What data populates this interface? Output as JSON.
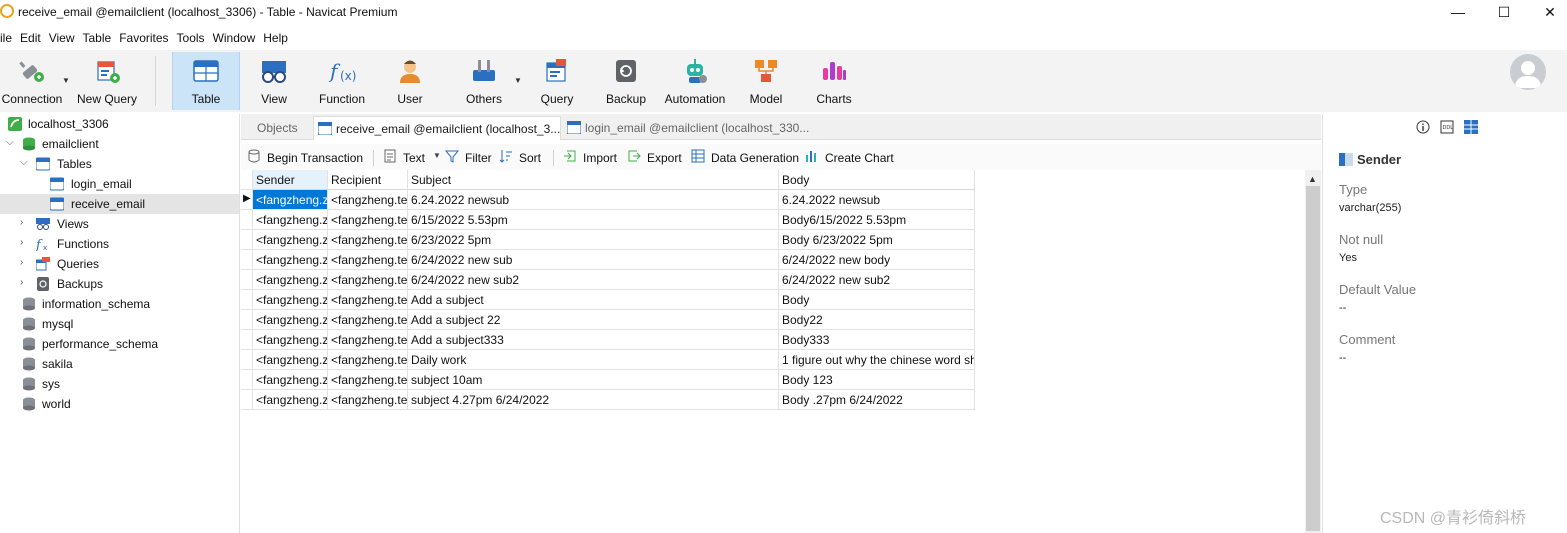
{
  "window": {
    "title": "receive_email @emailclient (localhost_3306) - Table - Navicat Premium",
    "minimize_glyph": "—",
    "maximize_glyph": "☐",
    "close_glyph": "✕"
  },
  "menu": [
    "ile",
    "Edit",
    "View",
    "Table",
    "Favorites",
    "Tools",
    "Window",
    "Help"
  ],
  "toolbar": {
    "connection": "Connection",
    "new_query": "New Query",
    "table": "Table",
    "view": "View",
    "function": "Function",
    "user": "User",
    "others": "Others",
    "query": "Query",
    "backup": "Backup",
    "automation": "Automation",
    "model": "Model",
    "charts": "Charts"
  },
  "tree": {
    "connection": "localhost_3306",
    "database": "emailclient",
    "tables": "Tables",
    "table_login": "login_email",
    "table_receive": "receive_email",
    "views": "Views",
    "functions": "Functions",
    "queries": "Queries",
    "backups": "Backups",
    "other_dbs": [
      "information_schema",
      "mysql",
      "performance_schema",
      "sakila",
      "sys",
      "world"
    ]
  },
  "tabs": {
    "objects": "Objects",
    "receive": "receive_email @emailclient (localhost_3...",
    "login": "login_email @emailclient (localhost_330..."
  },
  "object_toolbar": {
    "begin_transaction": "Begin Transaction",
    "text": "Text",
    "filter": "Filter",
    "sort": "Sort",
    "import": "Import",
    "export": "Export",
    "data_generation": "Data Generation",
    "create_chart": "Create Chart"
  },
  "grid": {
    "columns": [
      "Sender",
      "Recipient",
      "Subject",
      "Body"
    ],
    "rows": [
      [
        "<fangzheng.z",
        "<fangzheng.te",
        "6.24.2022 newsub",
        "6.24.2022 newsub"
      ],
      [
        "<fangzheng.z",
        "<fangzheng.te",
        "6/15/2022 5.53pm",
        "Body6/15/2022 5.53pm"
      ],
      [
        "<fangzheng.z",
        "<fangzheng.te",
        "6/23/2022 5pm",
        "Body 6/23/2022 5pm"
      ],
      [
        "<fangzheng.z",
        "<fangzheng.te",
        "6/24/2022 new sub",
        "6/24/2022 new body"
      ],
      [
        "<fangzheng.z",
        "<fangzheng.te",
        "6/24/2022 new sub2",
        "6/24/2022 new sub2"
      ],
      [
        "<fangzheng.z",
        "<fangzheng.te",
        "Add a subject",
        "Body"
      ],
      [
        "<fangzheng.z",
        "<fangzheng.te",
        "Add a subject 22",
        "Body22"
      ],
      [
        "<fangzheng.z",
        "<fangzheng.te",
        "Add a subject333",
        "Body333"
      ],
      [
        "<fangzheng.z",
        "<fangzheng.te",
        "Daily work",
        "1 figure out why the chinese word sh"
      ],
      [
        "<fangzheng.z",
        "<fangzheng.te",
        "subject 10am",
        "Body 123"
      ],
      [
        "<fangzheng.z",
        "<fangzheng.te",
        "subject 4.27pm 6/24/2022",
        "Body .27pm 6/24/2022"
      ]
    ]
  },
  "info": {
    "title": "Sender",
    "type_label": "Type",
    "type_value": "varchar(255)",
    "notnull_label": "Not null",
    "notnull_value": "Yes",
    "default_label": "Default Value",
    "default_value": "--",
    "comment_label": "Comment",
    "comment_value": "--"
  },
  "watermark": "CSDN @青衫倚斜桥",
  "colors": {
    "accent": "#0078d7",
    "toolbar_active": "#cce4f7"
  }
}
